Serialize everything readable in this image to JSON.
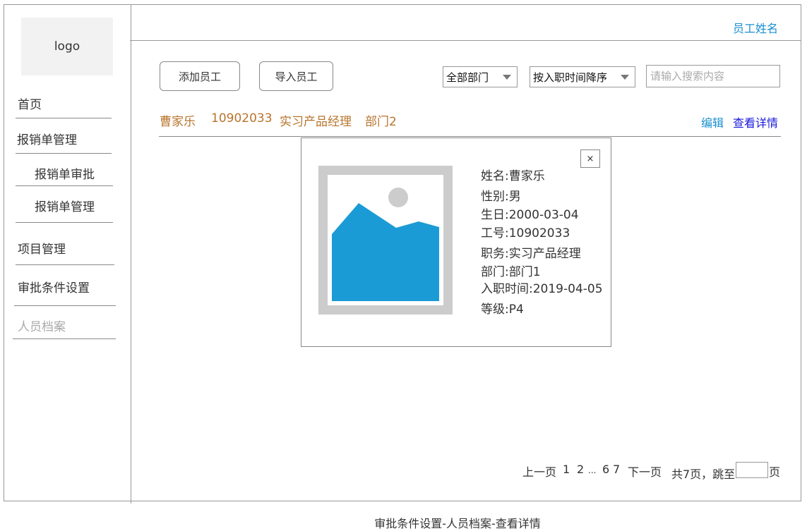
{
  "logo": {
    "text": "logo"
  },
  "header": {
    "user_name": "员工姓名"
  },
  "sidebar": {
    "items": [
      {
        "label": "首页"
      },
      {
        "label": "报销单管理"
      },
      {
        "label": "报销单审批"
      },
      {
        "label": "报销单管理"
      },
      {
        "label": "项目管理"
      },
      {
        "label": "审批条件设置"
      },
      {
        "label": "人员档案"
      }
    ]
  },
  "toolbar": {
    "add_label": "添加员工",
    "import_label": "导入员工",
    "department_filter": "全部部门",
    "sort_filter": "按入职时间降序",
    "search_placeholder": "请输入搜索内容"
  },
  "employee_row": {
    "name": "曹家乐",
    "id": "10902033",
    "title": "实习产品经理",
    "department": "部门2",
    "edit_label": "编辑",
    "details_label": "查看详情"
  },
  "detail": {
    "close_label": "×",
    "name": "姓名:曹家乐",
    "gender": "性别:男",
    "birthday": "生日:2000-03-04",
    "employee_id": "工号:10902033",
    "position": "职务:实习产品经理",
    "department": "部门:部门1",
    "hire_date": "入职时间:2019-04-05",
    "level": "等级:P4"
  },
  "pagination": {
    "prev": "上一页",
    "current": "1",
    "page2": "2",
    "ellipsis": "...",
    "page6": "6",
    "page7": "7",
    "next": "下一页",
    "total": "共7页，跳至",
    "suffix": "页"
  },
  "caption": "审批条件设置-人员档案-查看详情",
  "colors": {
    "link": "#1b8fd1",
    "row_text": "#b8742c",
    "details_link": "#1a1adb",
    "photo_frame": "#cccccc",
    "photo_fill": "#1b9bd5"
  }
}
